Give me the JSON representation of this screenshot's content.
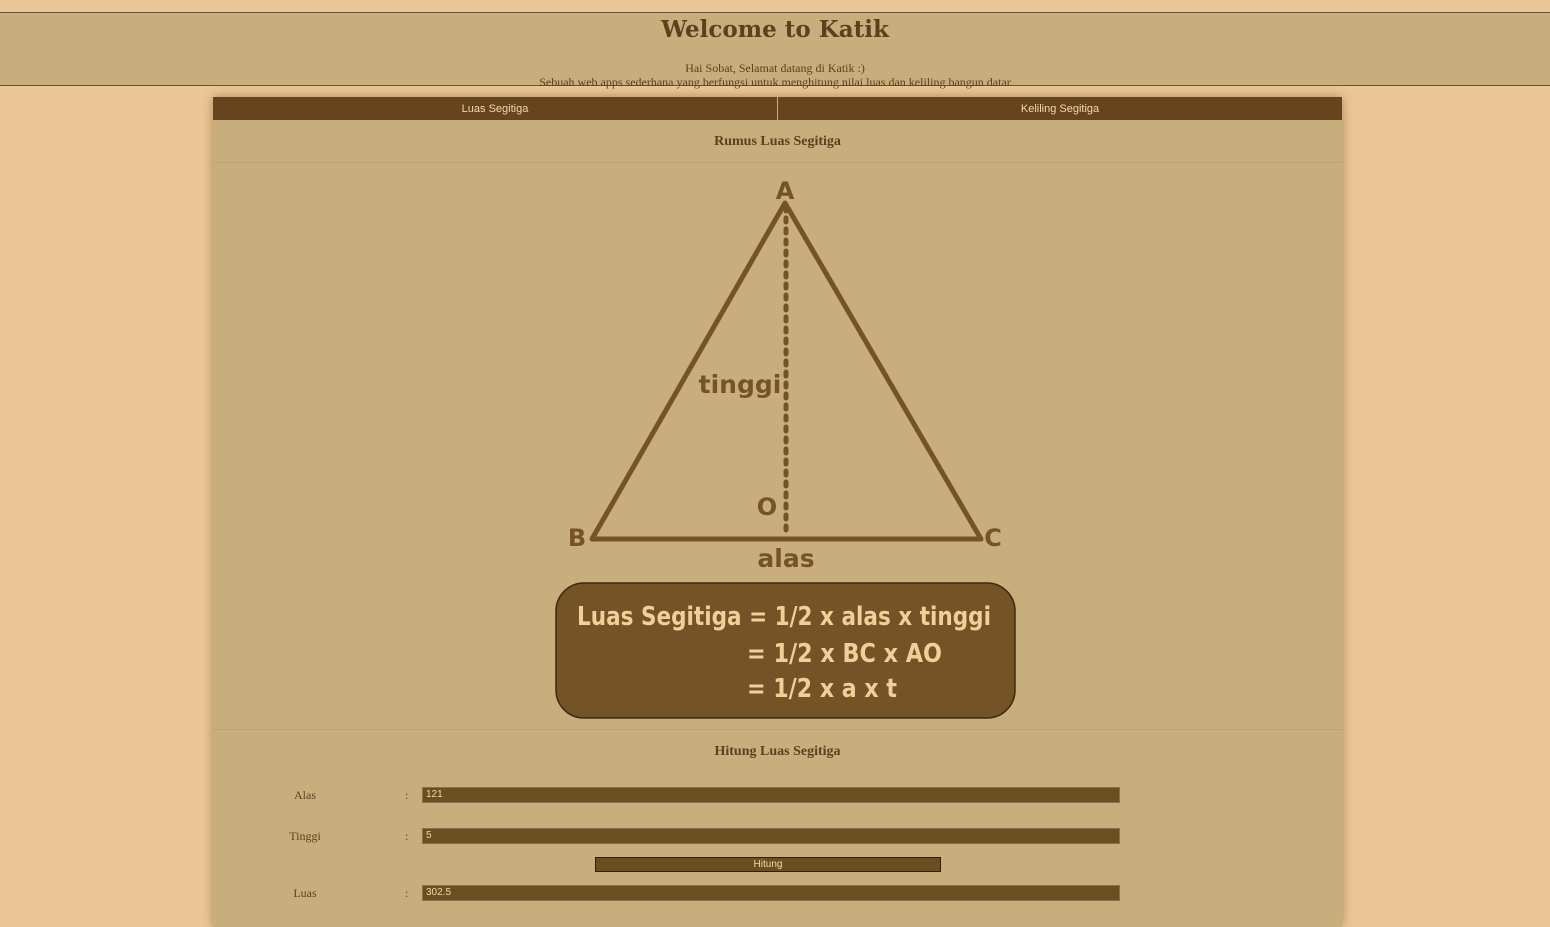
{
  "header": {
    "title": "Welcome to Katik",
    "line1": "Hai Sobat, Selamat datang di Katik :)",
    "line2": "Sebuah web apps sederhana yang berfungsi untuk menghitung nilai luas dan keliling bangun datar"
  },
  "tabs": [
    {
      "label": "Luas Segitiga"
    },
    {
      "label": "Keliling Segitiga"
    }
  ],
  "formula_section": {
    "title": "Rumus Luas Segitiga",
    "diagram": {
      "vertex_a": "A",
      "vertex_b": "B",
      "vertex_c": "C",
      "point_o": "O",
      "height_label": "tinggi",
      "base_label": "alas",
      "formula_line1": "Luas Segitiga = 1/2 x alas x tinggi",
      "formula_line2": "= 1/2 x BC x AO",
      "formula_line3": "= 1/2 x a x t"
    }
  },
  "calc_section": {
    "title": "Hitung Luas Segitiga",
    "alas_label": "Alas",
    "alas_value": "121",
    "tinggi_label": "Tinggi",
    "tinggi_value": "5",
    "button_label": "Hitung",
    "luas_label": "Luas",
    "luas_value": "302.5",
    "colon": ":"
  },
  "colors": {
    "background": "#ebc696",
    "panel": "#c8ae7c",
    "dark_brown": "#66451e",
    "text": "#5c411f"
  }
}
